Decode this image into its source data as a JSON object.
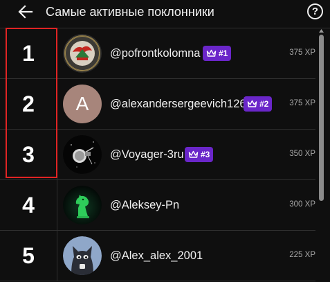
{
  "header": {
    "back_icon": "arrow-left-icon",
    "title": "Самые активные поклонники",
    "help_icon": "question-circle-icon",
    "help_label": "?"
  },
  "colors": {
    "background": "#0f0f0f",
    "badge": "#6a26c9",
    "highlight_border": "#e02424",
    "xp_text": "#aaaaaa"
  },
  "fans": [
    {
      "rank": "1",
      "username": "@pofrontkolomna",
      "badge": "#1",
      "xp": "375 XP",
      "avatar": "emblem-avatar"
    },
    {
      "rank": "2",
      "username": "@alexandersergeevich126",
      "badge": "#2",
      "xp": "375 XP",
      "avatar": "letter-avatar",
      "avatar_letter": "A"
    },
    {
      "rank": "3",
      "username": "@Voyager-3ru",
      "badge": "#3",
      "xp": "350 XP",
      "avatar": "spacecraft-avatar"
    },
    {
      "rank": "4",
      "username": "@Aleksey-Pn",
      "badge": "",
      "xp": "300 XP",
      "avatar": "chess-knight-avatar"
    },
    {
      "rank": "5",
      "username": "@Alex_alex_2001",
      "badge": "",
      "xp": "225 XP",
      "avatar": "cat-avatar"
    }
  ]
}
